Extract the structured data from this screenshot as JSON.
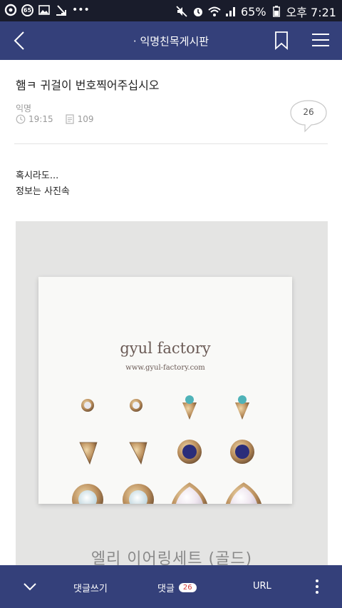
{
  "status_bar": {
    "notification_badge": "65",
    "battery": "65%",
    "clock": "오후 7:21"
  },
  "nav": {
    "title": "· 익명친목게시판"
  },
  "post": {
    "title": "햄ㅋ 귀걸이 번호찍어주십시오",
    "author": "익명",
    "time": "19:15",
    "views": "109",
    "comment_count": "26",
    "body_line1": "혹시라도...",
    "body_line2": "정보는 사진속"
  },
  "photo": {
    "brand": "gyul factory",
    "brand_url": "www.gyul-factory.com",
    "caption": "엘리 이어링세트 (골드)"
  },
  "bottom_bar": {
    "write_label": "댓글쓰기",
    "comments_label": "댓글",
    "comments_badge": "26",
    "url_label": "URL"
  },
  "colors": {
    "nav_bg": "#34407a",
    "status_bg": "#191c2b",
    "badge_text": "#d23a3a"
  }
}
